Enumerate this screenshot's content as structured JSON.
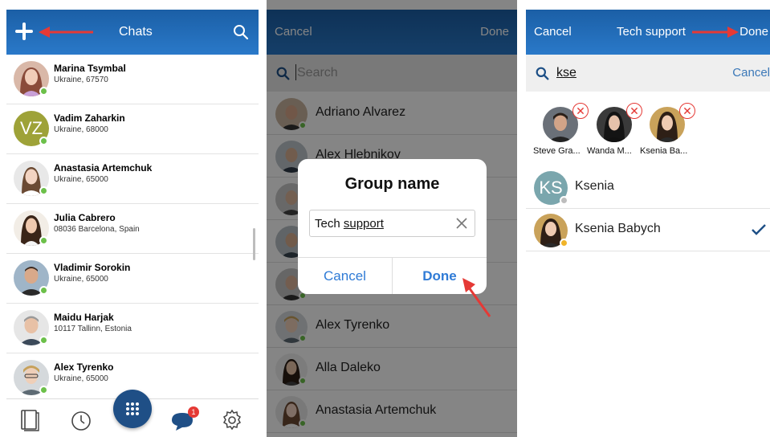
{
  "screen1": {
    "header": {
      "title": "Chats"
    },
    "contacts": [
      {
        "name": "Marina Tsymbal",
        "location": "Ukraine, 67570"
      },
      {
        "name": "Vadim Zaharkin",
        "location": "Ukraine, 68000",
        "initials": "VZ"
      },
      {
        "name": "Anastasia Artemchuk",
        "location": "Ukraine, 65000"
      },
      {
        "name": "Julia Cabrero",
        "location": "08036 Barcelona, Spain"
      },
      {
        "name": "Vladimir Sorokin",
        "location": "Ukraine, 65000"
      },
      {
        "name": "Maidu Harjak",
        "location": "10117 Tallinn, Estonia"
      },
      {
        "name": "Alex Tyrenko",
        "location": "Ukraine, 65000"
      }
    ],
    "bottom": {
      "chat_badge": "1"
    }
  },
  "screen2": {
    "header": {
      "cancel": "Cancel",
      "done": "Done"
    },
    "search": {
      "placeholder": "Search"
    },
    "contacts": [
      {
        "name": "Adriano Alvarez"
      },
      {
        "name": "Alex Hlebnikov"
      },
      {
        "name": "Alex Tyrenko"
      },
      {
        "name": "Alla Daleko"
      },
      {
        "name": "Anastasia Artemchuk"
      }
    ],
    "dialog": {
      "title": "Group name",
      "input_prefix": "Tech ",
      "input_word": "support",
      "cancel": "Cancel",
      "done": "Done"
    }
  },
  "screen3": {
    "header": {
      "cancel": "Cancel",
      "title": "Tech support",
      "done": "Done"
    },
    "search": {
      "query": "kse",
      "cancel": "Cancel"
    },
    "selected": [
      {
        "label": "Steve Gra..."
      },
      {
        "label": "Wanda M..."
      },
      {
        "label": "Ksenia Ba..."
      }
    ],
    "results": [
      {
        "name": "Ksenia",
        "initials": "KS"
      },
      {
        "name": "Ksenia Babych"
      }
    ]
  },
  "colors": {
    "header": "#2a79c9",
    "accent": "#2f7bd6",
    "online": "#6cc04a",
    "arrow": "#e53935"
  }
}
